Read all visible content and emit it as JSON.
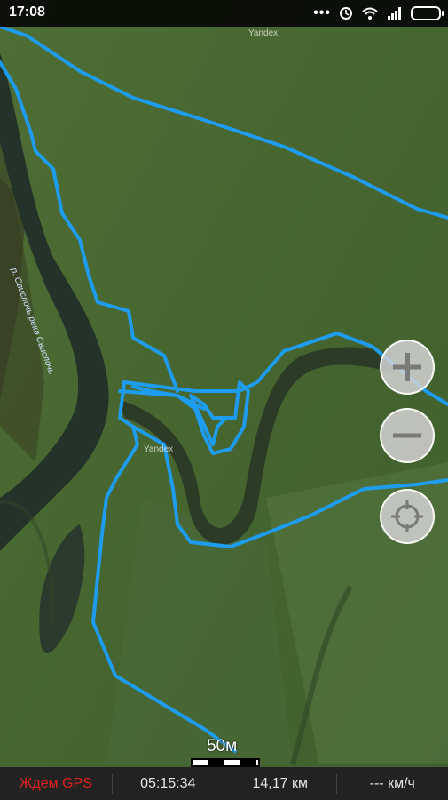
{
  "status_bar": {
    "time": "17:08",
    "icons": [
      "more-dots-icon",
      "alarm-icon",
      "wifi-icon",
      "signal-icon",
      "battery-icon"
    ],
    "dots": "•••"
  },
  "map": {
    "watermarks": [
      "Yandex",
      "Yandex"
    ],
    "river_label": "р. Свислочь река Свислочь",
    "track_color": "#1e9cf0"
  },
  "controls": {
    "zoom_in": "zoom-in-icon",
    "zoom_out": "zoom-out-icon",
    "locate": "locate-icon"
  },
  "scale": {
    "label": "50м"
  },
  "bottom_bar": {
    "gps_status": "Ждем GPS",
    "duration": "05:15:34",
    "distance": "14,17 км",
    "speed": "--- км/ч",
    "gps_color": "#e32020"
  }
}
